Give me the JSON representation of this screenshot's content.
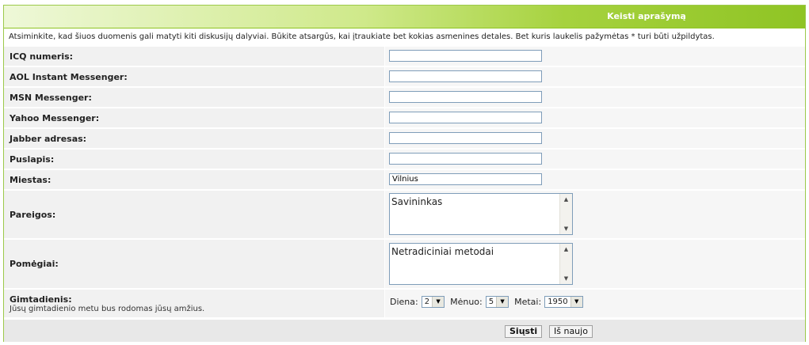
{
  "header": {
    "title": "Keisti aprašymą"
  },
  "notice": "Atsiminkite, kad šiuos duomenis gali matyti kiti diskusijų dalyviai. Būkite atsargūs, kai įtraukiate bet kokias asmenines detales. Bet kuris laukelis pažymėtas * turi būti užpildytas.",
  "fields": {
    "icq": {
      "label": "ICQ numeris:",
      "value": ""
    },
    "aol": {
      "label": "AOL Instant Messenger:",
      "value": ""
    },
    "msn": {
      "label": "MSN Messenger:",
      "value": ""
    },
    "yahoo": {
      "label": "Yahoo Messenger:",
      "value": ""
    },
    "jabber": {
      "label": "Jabber adresas:",
      "value": ""
    },
    "website": {
      "label": "Puslapis:",
      "value": ""
    },
    "location": {
      "label": "Miestas:",
      "value": "Vilnius"
    },
    "occupation": {
      "label": "Pareigos:",
      "value": "Savininkas"
    },
    "interests": {
      "label": "Pomėgiai:",
      "value": "Netradiciniai metodai"
    }
  },
  "birthday": {
    "label": "Gimtadienis:",
    "hint": "Jūsų gimtadienio metu bus rodomas jūsų amžius.",
    "day_label": "Diena:",
    "day_value": "2",
    "month_label": "Mėnuo:",
    "month_value": "5",
    "year_label": "Metai:",
    "year_value": "1950"
  },
  "buttons": {
    "submit": "Siųsti",
    "reset": "Iš naujo"
  },
  "colors": {
    "accent": "#8fc424",
    "border": "#9cc94a"
  }
}
